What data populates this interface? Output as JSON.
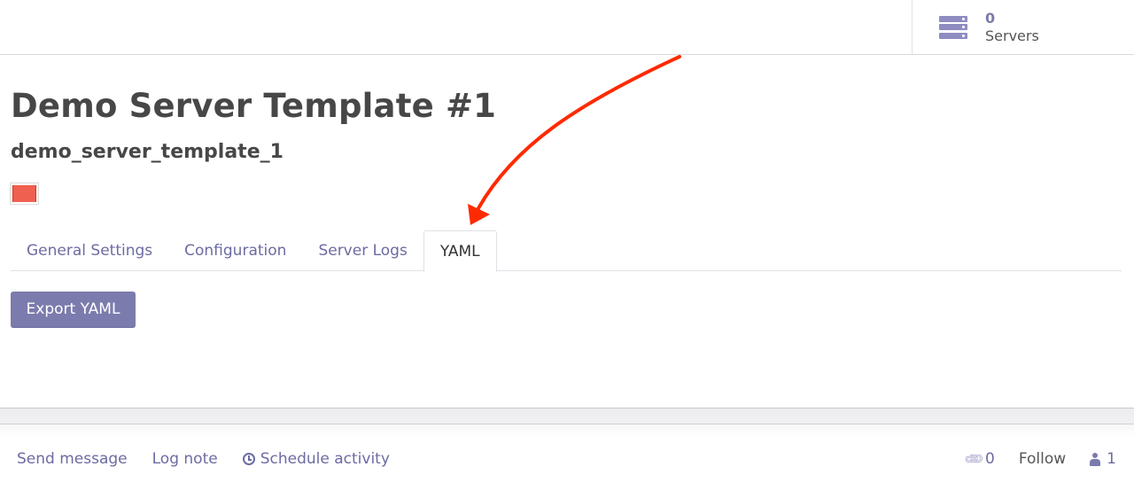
{
  "stat_button": {
    "value": "0",
    "label": "Servers",
    "icon": "server-icon"
  },
  "record": {
    "title": "Demo Server Template #1",
    "reference": "demo_server_template_1",
    "color": "#f06050"
  },
  "tabs": [
    {
      "label": "General Settings",
      "active": false
    },
    {
      "label": "Configuration",
      "active": false
    },
    {
      "label": "Server Logs",
      "active": false
    },
    {
      "label": "YAML",
      "active": true
    }
  ],
  "yaml_tab": {
    "export_button": "Export YAML"
  },
  "chatter": {
    "send_message": "Send message",
    "log_note": "Log note",
    "schedule_activity": "Schedule activity",
    "attachments_count": "0",
    "follow": "Follow",
    "followers_count": "1"
  },
  "annotation": {
    "type": "arrow",
    "color": "#ff2a00",
    "points_to": "YAML tab"
  }
}
